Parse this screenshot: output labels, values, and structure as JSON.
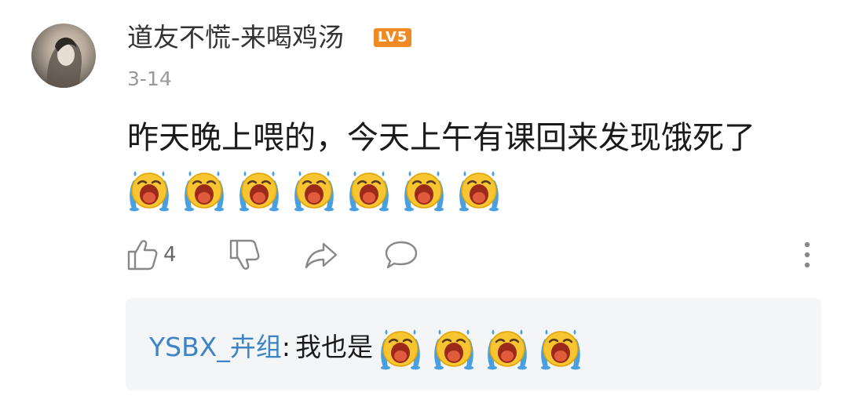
{
  "comment": {
    "username": "道友不慌-来喝鸡汤",
    "level": "LV5",
    "date": "3-14",
    "text": "昨天晚上喂的，今天上午有课回来发现饿死了",
    "emojis": [
      "crying-emoji",
      "crying-emoji",
      "crying-emoji",
      "crying-emoji",
      "crying-emoji",
      "crying-emoji",
      "crying-emoji"
    ]
  },
  "actions": {
    "like_count": "4",
    "like_icon": "thumbs-up-icon",
    "dislike_icon": "thumbs-down-icon",
    "share_icon": "share-icon",
    "reply_icon": "comment-icon",
    "more_icon": "more-vertical-icon"
  },
  "reply": {
    "user": "YSBX_卉组",
    "colon": ":",
    "text": "我也是",
    "emojis": [
      "crying-emoji",
      "crying-emoji",
      "crying-emoji",
      "crying-emoji"
    ]
  },
  "colors": {
    "username": "#333333",
    "level_badge": "#f08a24",
    "date": "#999999",
    "reply_user": "#3d84c6",
    "reply_bg": "#f4f5f7",
    "icon": "#888888"
  }
}
